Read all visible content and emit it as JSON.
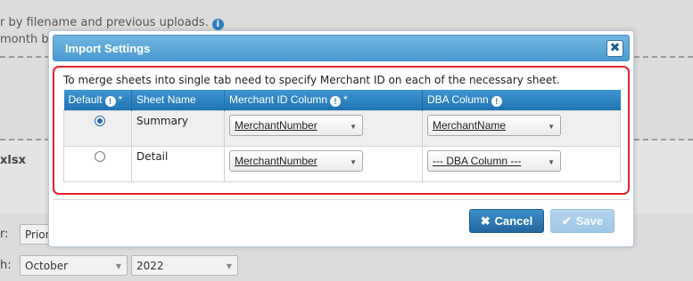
{
  "background": {
    "line1": "r by filename and previous uploads.",
    "line2": "month ba",
    "info_icon": "i",
    "file_label": "xlsx",
    "label_1": "r:",
    "label_2": "h:",
    "prior_select": "Prior",
    "month_select": "October",
    "year_select": "2022"
  },
  "modal": {
    "title": "Import Settings",
    "close_icon": "✖",
    "merge_note": "To merge sheets into single tab need to specify Merchant ID on each of the necessary sheet.",
    "columns": {
      "default": "Default",
      "sheet_name": "Sheet Name",
      "merchant_id": "Merchant ID Column",
      "dba": "DBA Column",
      "info_icon": "!",
      "required_mark": "*"
    },
    "rows": [
      {
        "default_selected": true,
        "sheet_name": "Summary",
        "merchant_id": "MerchantNumber",
        "dba": "MerchantName"
      },
      {
        "default_selected": false,
        "sheet_name": "Detail",
        "merchant_id": "MerchantNumber",
        "dba": "--- DBA Column ---"
      }
    ],
    "cancel_label": "Cancel",
    "save_label": "Save",
    "cancel_icon": "✖",
    "save_icon": "✔"
  },
  "colors": {
    "header_blue": "#4b9bd1",
    "table_header_blue": "#1f74b3",
    "highlight_red": "#e8222b",
    "cancel_blue": "#23679f",
    "save_disabled_blue": "#9fc7e6"
  }
}
